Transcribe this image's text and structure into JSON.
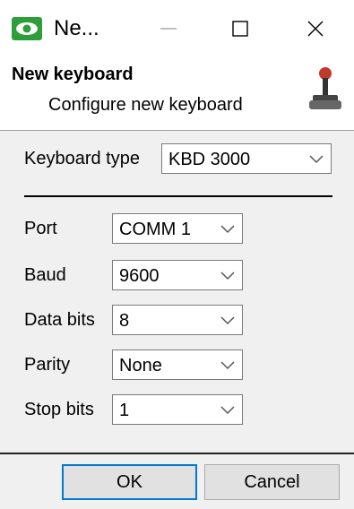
{
  "window": {
    "title": "Ne...",
    "icon": "eye-app-icon",
    "controls": [
      "minimize-icon",
      "maximize-icon",
      "close-icon"
    ]
  },
  "header": {
    "title": "New keyboard",
    "subtitle": "Configure new keyboard",
    "icon": "joystick-icon"
  },
  "keyboard": {
    "type_label": "Keyboard type",
    "type_value": "KBD 3000"
  },
  "settings": [
    {
      "label": "Port",
      "value": "COMM 1"
    },
    {
      "label": "Baud",
      "value": "9600"
    },
    {
      "label": "Data bits",
      "value": "8"
    },
    {
      "label": "Parity",
      "value": "None"
    },
    {
      "label": "Stop bits",
      "value": "1"
    }
  ],
  "buttons": {
    "ok": "OK",
    "cancel": "Cancel"
  },
  "colors": {
    "accent": "#0078d7",
    "icon_green": "#2e9e3a"
  }
}
